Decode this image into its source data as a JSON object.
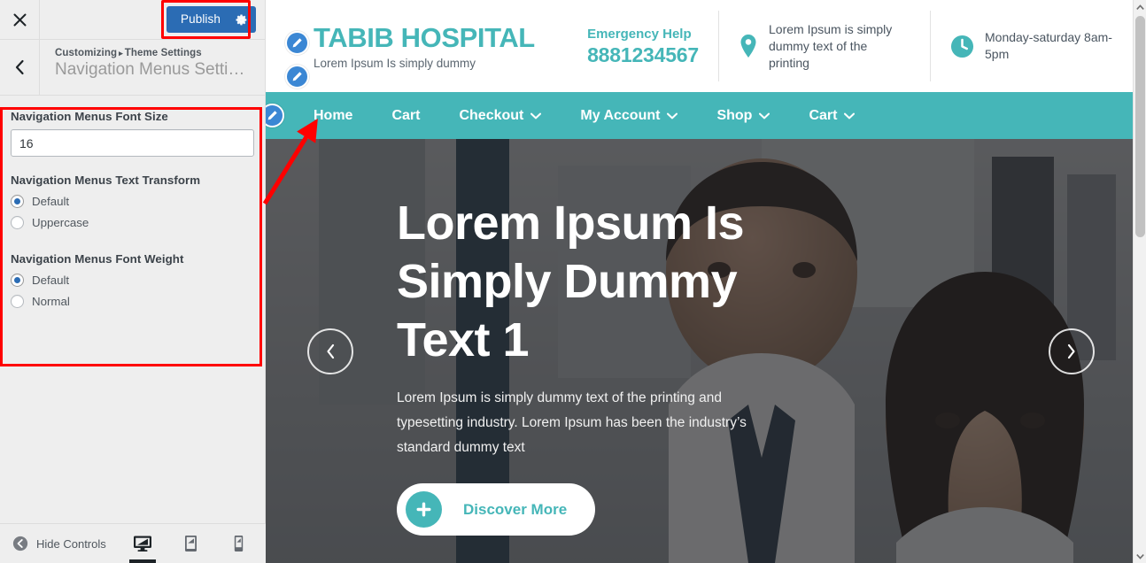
{
  "customizer": {
    "close_label": "Close",
    "publish_label": "Publish",
    "gear_label": "Publish settings",
    "breadcrumb_root": "Customizing",
    "breadcrumb_separator": "▸",
    "breadcrumb_parent": "Theme Settings",
    "panel_title": "Navigation Menus Setti…",
    "back_label": "Back",
    "hide_controls_label": "Hide Controls",
    "devices": [
      {
        "name": "desktop",
        "label": "Desktop",
        "active": true
      },
      {
        "name": "tablet",
        "label": "Tablet",
        "active": false
      },
      {
        "name": "mobile",
        "label": "Mobile",
        "active": false
      }
    ],
    "settings": {
      "font_size": {
        "label": "Navigation Menus Font Size",
        "value": "16"
      },
      "text_transform": {
        "label": "Navigation Menus Text Transform",
        "options": [
          {
            "label": "Default",
            "selected": true
          },
          {
            "label": "Uppercase",
            "selected": false
          }
        ]
      },
      "font_weight": {
        "label": "Navigation Menus Font Weight",
        "options": [
          {
            "label": "Default",
            "selected": true
          },
          {
            "label": "Normal",
            "selected": false
          }
        ]
      }
    },
    "highlight_color": "#ff0000",
    "publish_color": "#2b6cb4"
  },
  "preview": {
    "site_title": "TABIB HOSPITAL",
    "site_tagline": "Lorem Ipsum Is simply dummy",
    "accent_color": "#45b6b8",
    "header_info": [
      {
        "icon": "phone-emergency",
        "label": "Emergency Help",
        "value": "8881234567"
      },
      {
        "icon": "map-pin-icon",
        "text": "Lorem Ipsum is simply dummy text of the printing"
      },
      {
        "icon": "clock-icon",
        "text": "Monday-saturday 8am-5pm"
      }
    ],
    "nav_items": [
      {
        "label": "Home",
        "has_dropdown": false
      },
      {
        "label": "Cart",
        "has_dropdown": false
      },
      {
        "label": "Checkout",
        "has_dropdown": true
      },
      {
        "label": "My Account",
        "has_dropdown": true
      },
      {
        "label": "Shop",
        "has_dropdown": true
      },
      {
        "label": "Cart",
        "has_dropdown": true
      }
    ],
    "hero": {
      "title": "Lorem Ipsum Is Simply Dummy Text 1",
      "subtitle": "Lorem Ipsum is simply dummy text of the printing and typesetting industry. Lorem Ipsum has been the industry’s standard dummy text",
      "cta_label": "Discover More",
      "prev_label": "Previous slide",
      "next_label": "Next slide"
    }
  }
}
